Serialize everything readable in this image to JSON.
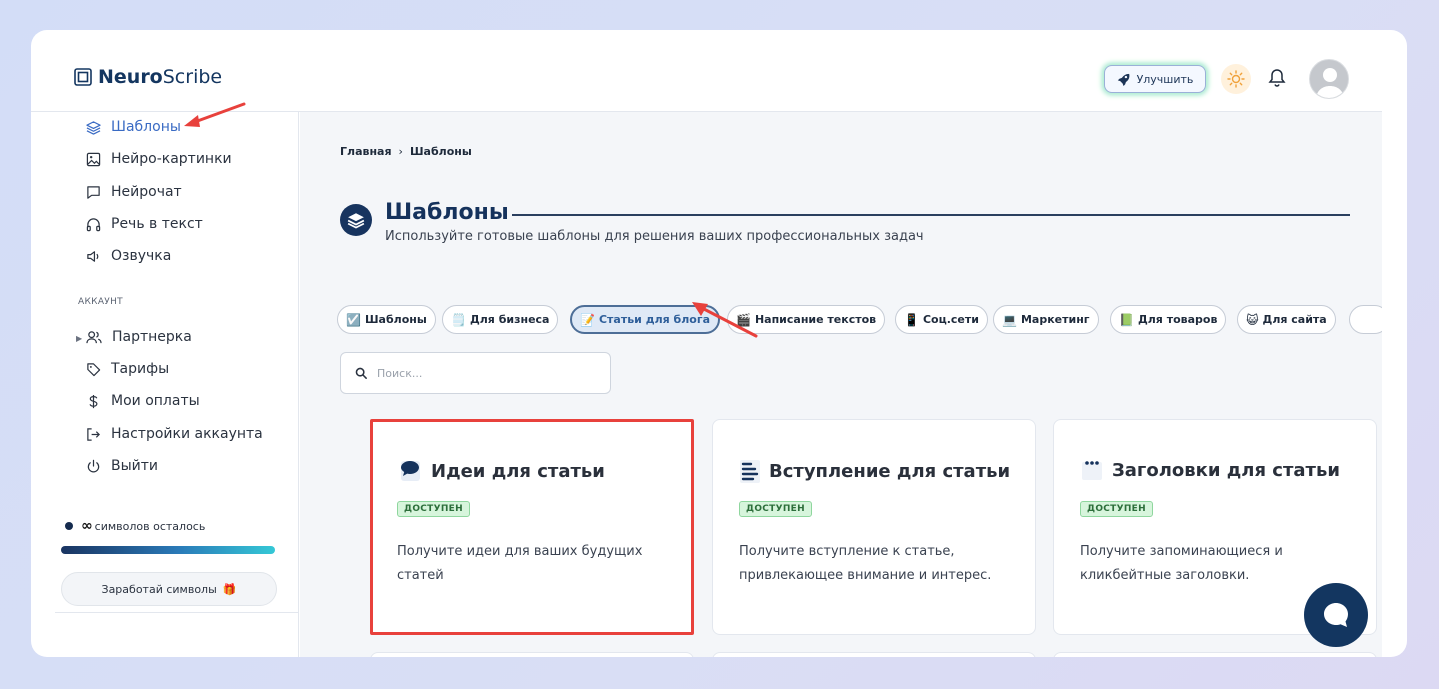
{
  "header": {
    "logo_bold": "Neuro",
    "logo_light": "Scribe",
    "upgrade_label": "Улучшить"
  },
  "sidebar": {
    "items": [
      {
        "label": "Шаблоны",
        "icon": "layers-icon"
      },
      {
        "label": "Нейро-картинки",
        "icon": "image-icon"
      },
      {
        "label": "Нейрочат",
        "icon": "chat-icon"
      },
      {
        "label": "Речь в текст",
        "icon": "headphones-icon"
      },
      {
        "label": "Озвучка",
        "icon": "speaker-icon"
      }
    ],
    "section_label": "АККАУНТ",
    "account_items": [
      {
        "label": "Партнерка",
        "icon": "users-icon"
      },
      {
        "label": "Тарифы",
        "icon": "tag-icon"
      },
      {
        "label": "Мои оплаты",
        "icon": "dollar-icon"
      },
      {
        "label": "Настройки аккаунта",
        "icon": "settings-exit-icon"
      },
      {
        "label": "Выйти",
        "icon": "power-icon"
      }
    ],
    "credits_symbol": "∞",
    "credits_text": "символов осталось",
    "credits_progress": 1.0,
    "earn_label": "Заработай символы"
  },
  "breadcrumb": {
    "home": "Главная",
    "separator": "›",
    "current": "Шаблоны"
  },
  "page": {
    "title": "Шаблоны",
    "subtitle": "Используйте готовые шаблоны для решения ваших профессиональных задач"
  },
  "chips": [
    {
      "emoji": "☑️",
      "label": "Шаблоны"
    },
    {
      "emoji": "🗒️",
      "label": "Для бизнеса"
    },
    {
      "emoji": "📝",
      "label": "Статьи для блога",
      "active": true
    },
    {
      "emoji": "🎬",
      "label": "Написание текстов"
    },
    {
      "emoji": "📱",
      "label": "Соц.сети"
    },
    {
      "emoji": "💻",
      "label": "Маркетинг"
    },
    {
      "emoji": "📗",
      "label": "Для товаров"
    },
    {
      "emoji": "😺",
      "label": "Для сайта"
    }
  ],
  "search": {
    "placeholder": "Поиск..."
  },
  "cards": [
    {
      "title": "Идеи для статьи",
      "badge": "ДОСТУПЕН",
      "description": "Получите идеи для ваших будущих статей",
      "icon": "speech-bubble-icon"
    },
    {
      "title": "Вступление для статьи",
      "badge": "ДОСТУПЕН",
      "description": "Получите вступление к статье, привлекающее внимание и интерес.",
      "icon": "text-lines-icon"
    },
    {
      "title": "Заголовки для статьи",
      "badge": "ДОСТУПЕН",
      "description": "Получите запоминающиеся и кликбейтные заголовки.",
      "icon": "notepad-icon"
    }
  ],
  "colors": {
    "accent": "#17345f",
    "active_link": "#3a6bc4",
    "highlight": "#e8413c",
    "badge_bg": "#d7f5dc"
  }
}
